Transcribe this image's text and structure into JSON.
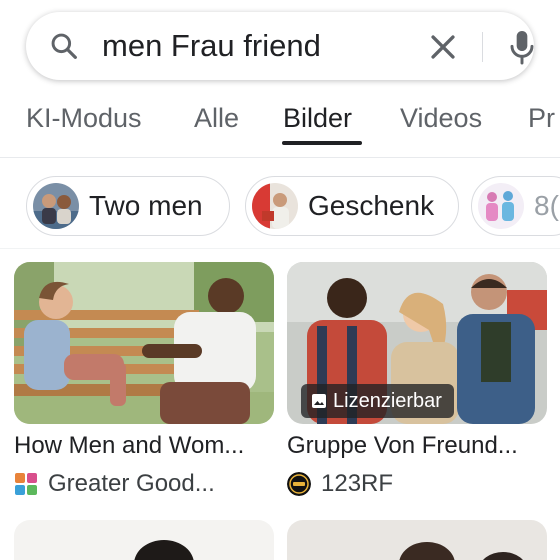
{
  "search": {
    "query": "men Frau friend",
    "search_icon": "search-icon",
    "clear_icon": "close-icon",
    "mic_icon": "microphone-icon"
  },
  "tabs": [
    {
      "label": "KI-Modus",
      "active": false
    },
    {
      "label": "Alle",
      "active": false
    },
    {
      "label": "Bilder",
      "active": true
    },
    {
      "label": "Videos",
      "active": false
    },
    {
      "label": "Pr",
      "active": false
    }
  ],
  "chips": [
    {
      "label": "Two men"
    },
    {
      "label": "Geschenk"
    },
    {
      "label": "8("
    }
  ],
  "results": [
    {
      "title": "How Men and Wom...",
      "source": "Greater Good...",
      "badge": ""
    },
    {
      "title": "Gruppe Von Freund...",
      "source": "123RF",
      "badge": "Lizenzierbar"
    }
  ],
  "colors": {
    "text": "#202124",
    "muted": "#5f6368",
    "border": "#dadce0"
  }
}
